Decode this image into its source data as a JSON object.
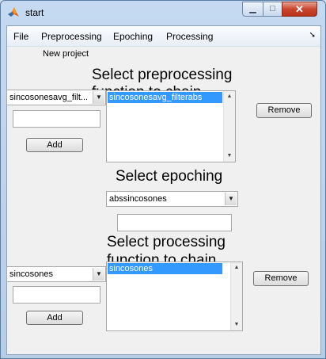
{
  "window": {
    "title": "start"
  },
  "menubar": {
    "items": [
      "File",
      "Preprocessing",
      "Epoching",
      "Processing"
    ]
  },
  "new_project_label": "New project",
  "preprocessing": {
    "heading_line1": "Select preprocessing",
    "heading_line2": "function to chain",
    "selected_function": "sincosonesavg_filt...",
    "input_value": "",
    "add_label": "Add",
    "chain_items": [
      "sincosonesavg_filterabs"
    ],
    "remove_label": "Remove"
  },
  "epoching": {
    "heading": "Select epoching",
    "selected_function": "abssincosones",
    "input_value": ""
  },
  "processing": {
    "heading_line1": "Select processing",
    "heading_line2": "function to chain",
    "selected_function": "sincosones",
    "input_value": "",
    "add_label": "Add",
    "chain_items": [
      "sincosones"
    ],
    "remove_label": "Remove"
  }
}
